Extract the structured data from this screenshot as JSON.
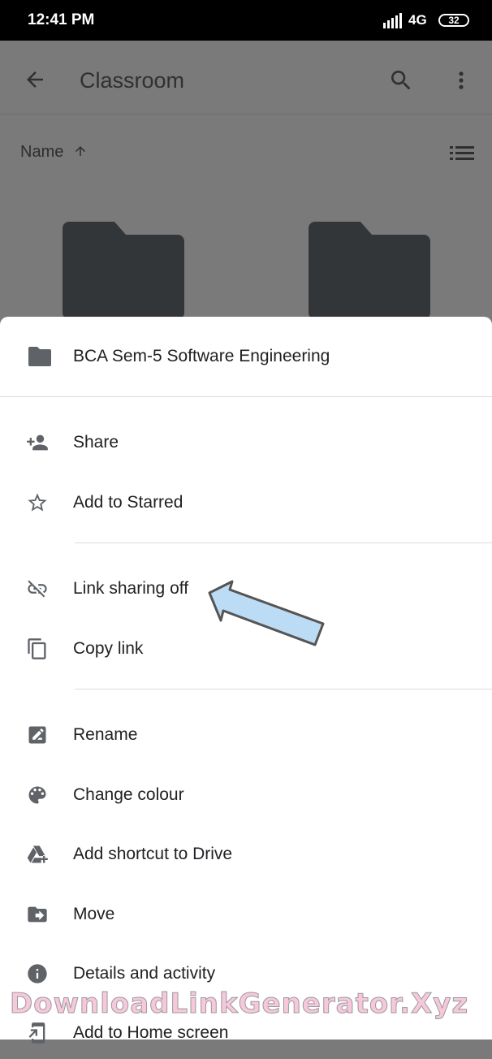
{
  "status_bar": {
    "time": "12:41 PM",
    "network": "4G",
    "battery": "32"
  },
  "app_bar": {
    "title": "Classroom",
    "back_icon": "arrow-left-icon",
    "search_icon": "search-icon",
    "more_icon": "more-vert-icon"
  },
  "sort": {
    "label": "Name",
    "direction": "ascending",
    "view_toggle_icon": "list-view-icon"
  },
  "colors": {
    "scrim": "#7a7a7a",
    "sheet": "#ffffff",
    "text": "#202124",
    "icon": "#5f6368",
    "arrow_fill": "#bcdcf5"
  },
  "sheet": {
    "header": {
      "icon": "folder-icon",
      "label": "BCA Sem-5 Software Engineering"
    },
    "groups": [
      {
        "items": [
          {
            "label": "Share",
            "icon": "person-add-icon"
          },
          {
            "label": "Add to Starred",
            "icon": "star-outline-icon"
          }
        ]
      },
      {
        "items": [
          {
            "label": "Link sharing off",
            "icon": "link-off-icon"
          },
          {
            "label": "Copy link",
            "icon": "copy-icon"
          }
        ]
      },
      {
        "items": [
          {
            "label": "Rename",
            "icon": "edit-icon"
          },
          {
            "label": "Change colour",
            "icon": "palette-icon"
          },
          {
            "label": "Add shortcut to Drive",
            "icon": "drive-shortcut-icon"
          },
          {
            "label": "Move",
            "icon": "move-folder-icon"
          },
          {
            "label": "Details and activity",
            "icon": "info-icon"
          },
          {
            "label": "Add to Home screen",
            "icon": "add-home-screen-icon"
          }
        ]
      }
    ]
  },
  "watermark": "DownloadLinkGenerator.Xyz"
}
